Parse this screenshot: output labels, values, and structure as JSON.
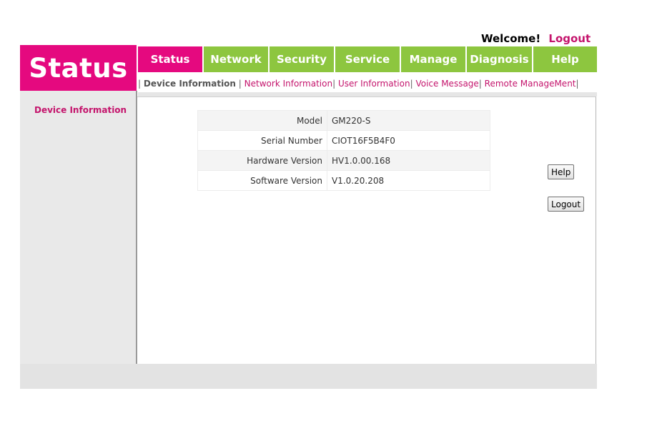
{
  "header": {
    "welcome_text": "Welcome!",
    "logout_label": "Logout",
    "logo_text": "Status"
  },
  "nav": {
    "tabs": [
      {
        "label": "Status",
        "active": true
      },
      {
        "label": "Network",
        "active": false
      },
      {
        "label": "Security",
        "active": false
      },
      {
        "label": "Service",
        "active": false
      },
      {
        "label": "Manage",
        "active": false
      },
      {
        "label": "Diagnosis",
        "active": false
      },
      {
        "label": "Help",
        "active": false
      }
    ]
  },
  "subnav": {
    "items": [
      {
        "label": "Device Information",
        "active": true
      },
      {
        "label": "Network Information",
        "active": false
      },
      {
        "label": "User Information",
        "active": false
      },
      {
        "label": "Voice Message",
        "active": false
      },
      {
        "label": "Remote ManageMent",
        "active": false
      }
    ]
  },
  "sidebar": {
    "items": [
      {
        "label": "Device Information"
      }
    ]
  },
  "device_info": {
    "rows": [
      {
        "label": "Model",
        "value": "GM220-S"
      },
      {
        "label": "Serial Number",
        "value": "CIOT16F5B4F0"
      },
      {
        "label": "Hardware Version",
        "value": "HV1.0.00.168"
      },
      {
        "label": "Software Version",
        "value": "V1.0.20.208"
      }
    ]
  },
  "buttons": {
    "help_label": "Help",
    "logout_label": "Logout"
  },
  "colors": {
    "brand_magenta": "#e5097f",
    "nav_green": "#8dc63f",
    "link_magenta": "#c4146c"
  }
}
